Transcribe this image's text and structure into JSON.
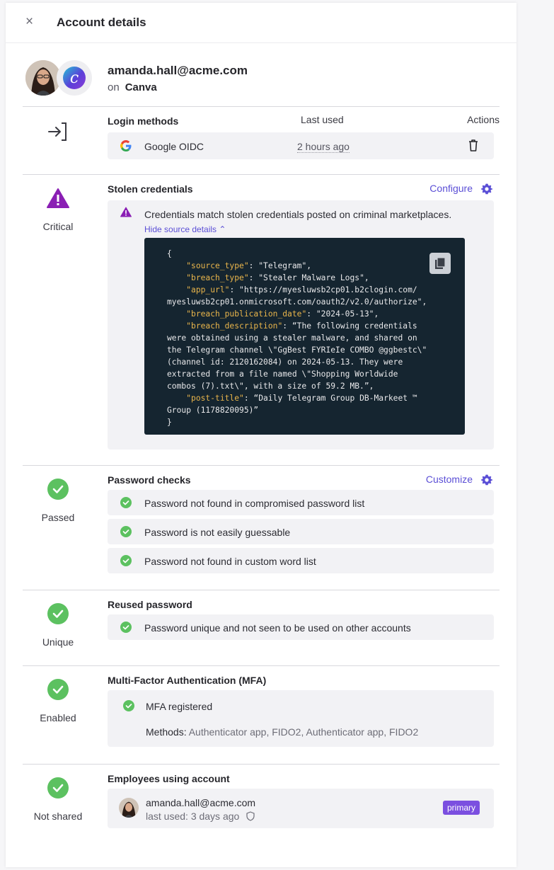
{
  "header": {
    "title": "Account details",
    "close_glyph": "×"
  },
  "account": {
    "email": "amanda.hall@acme.com",
    "on_label": "on",
    "app_name": "Canva",
    "app_logo_letter": "c"
  },
  "login_methods": {
    "title": "Login methods",
    "col_last_used": "Last used",
    "col_actions": "Actions",
    "rows": [
      {
        "method": "Google OIDC",
        "last_used": "2 hours ago",
        "icon": "google-icon"
      }
    ]
  },
  "stolen_credentials": {
    "status": "Critical",
    "title": "Stolen credentials",
    "configure_label": "Configure",
    "message": "Credentials match stolen credentials posted on criminal marketplaces.",
    "hide_label": "Hide source details",
    "code_lines": [
      "{",
      "    \"source_type\": \"Telegram\",",
      "    \"breach_type\": \"Stealer Malware Logs\",",
      "    \"app_url\": \"https://myesluwsb2cp01.b2clogin.com/",
      "myesluwsb2cp01.onmicrosoft.com/oauth2/v2.0/authorize\",",
      "    \"breach_publication_date\": \"2024-05-13\",",
      "    \"breach_description\": “The following credentials",
      "were obtained using a stealer malware, and shared on",
      "the Telegram channel \\\"GgBest FYRIeIe COMBO @ggbestc\\\"",
      "(channel id: 2120162084) on 2024-05-13. They were",
      "extracted from a file named \\\"Shopping Worldwide",
      "combos (7).txt\\\", with a size of 59.2 MB.”,",
      "    \"post-title\": “Daily Telegram Group DB-Markeet ™",
      "Group (1178820095)”",
      "}"
    ],
    "colors": {
      "critical": "#8a1fb4",
      "link": "#5b4fd6",
      "code_bg": "#152530",
      "code_key": "#e9b54b"
    }
  },
  "password_checks": {
    "status": "Passed",
    "title": "Password checks",
    "customize_label": "Customize",
    "items": [
      "Password not found in compromised password list",
      "Password is not easily guessable",
      "Password not found in custom word list"
    ]
  },
  "reused_password": {
    "status": "Unique",
    "title": "Reused password",
    "items": [
      "Password unique and not seen to be used on other accounts"
    ]
  },
  "mfa": {
    "status": "Enabled",
    "title": "Multi-Factor Authentication (MFA)",
    "registered_label": "MFA registered",
    "methods_label": "Methods:",
    "methods_value": "Authenticator app, FIDO2, Authenticator app, FIDO2"
  },
  "employees": {
    "status": "Not shared",
    "title": "Employees using account",
    "email": "amanda.hall@acme.com",
    "last_used": "last used: 3 days ago",
    "badge": "primary"
  },
  "status_colors": {
    "success": "#5cc160"
  }
}
